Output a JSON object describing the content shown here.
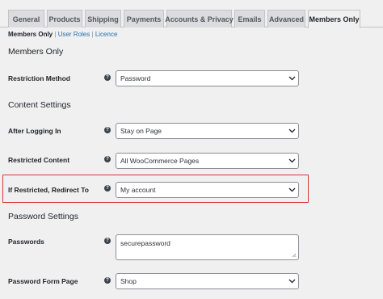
{
  "tabs": [
    {
      "label": "General"
    },
    {
      "label": "Products"
    },
    {
      "label": "Shipping"
    },
    {
      "label": "Payments"
    },
    {
      "label": "Accounts & Privacy"
    },
    {
      "label": "Emails"
    },
    {
      "label": "Advanced"
    },
    {
      "label": "Members Only",
      "active": true
    }
  ],
  "subnav": {
    "current": "Members Only",
    "links": [
      "User Roles",
      "Licence"
    ],
    "separator": "|"
  },
  "sections": {
    "members_only": "Members Only",
    "content_settings": "Content Settings",
    "password_settings": "Password Settings"
  },
  "fields": {
    "restriction_method": {
      "label": "Restriction Method",
      "value": "Password"
    },
    "after_logging_in": {
      "label": "After Logging In",
      "value": "Stay on Page"
    },
    "restricted_content": {
      "label": "Restricted Content",
      "value": "All WooCommerce Pages"
    },
    "if_restricted_redirect": {
      "label": "If Restricted, Redirect To",
      "value": "My account"
    },
    "passwords": {
      "label": "Passwords",
      "value": "securepassword"
    },
    "password_form_page": {
      "label": "Password Form Page",
      "value": "Shop"
    }
  },
  "help_icon_glyph": "?",
  "colors": {
    "link": "#2271b1",
    "highlight_border": "#d63638",
    "background": "#f0f0f1"
  }
}
